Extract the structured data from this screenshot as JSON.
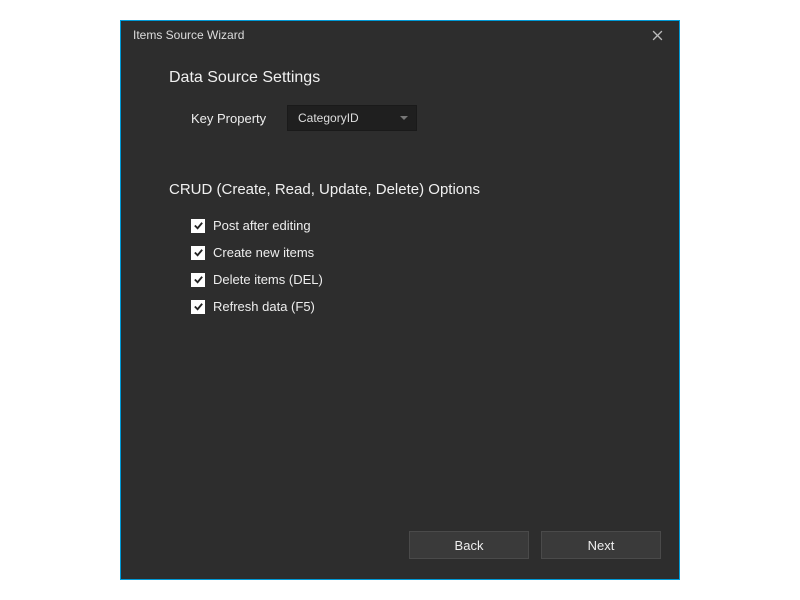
{
  "titlebar": {
    "title": "Items Source Wizard"
  },
  "sections": {
    "dataSource": {
      "heading": "Data Source Settings",
      "keyProperty": {
        "label": "Key Property",
        "value": "CategoryID"
      }
    },
    "crud": {
      "heading": "CRUD (Create, Read, Update, Delete) Options",
      "options": [
        {
          "label": "Post after editing",
          "checked": true
        },
        {
          "label": "Create new items",
          "checked": true
        },
        {
          "label": "Delete items (DEL)",
          "checked": true
        },
        {
          "label": "Refresh data (F5)",
          "checked": true
        }
      ]
    }
  },
  "footer": {
    "back": "Back",
    "next": "Next"
  }
}
